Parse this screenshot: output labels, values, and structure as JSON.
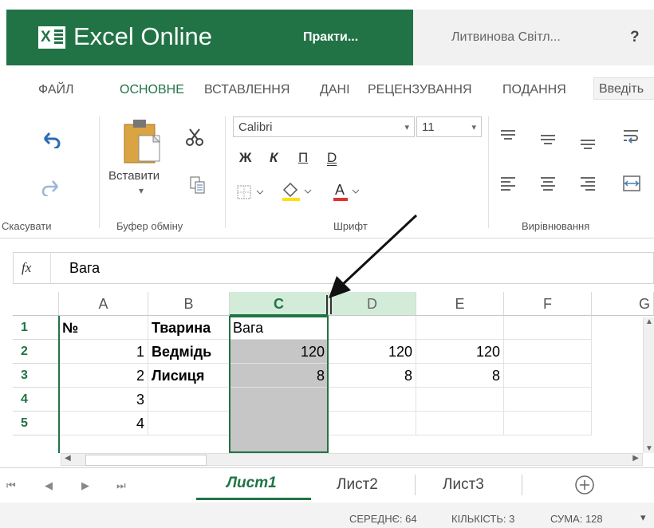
{
  "app": {
    "title": "Excel Online",
    "document": "Практи...",
    "user": "Литвинова Світл...",
    "help": "?"
  },
  "ribbon_tabs": [
    "ФАЙЛ",
    "ОСНОВНЕ",
    "ВСТАВЛЕННЯ",
    "ДАНІ",
    "РЕЦЕНЗУВАННЯ",
    "ПОДАННЯ"
  ],
  "tell_me_placeholder": "Введіть",
  "ribbon": {
    "undo_group": "Скасувати",
    "clipboard_group": "Буфер обміну",
    "paste_label": "Вставити",
    "font_group": "Шрифт",
    "alignment_group": "Вирівнювання",
    "font_name": "Calibri",
    "font_size": "11",
    "bold": "Ж",
    "italic": "К",
    "underline": "П",
    "double_underline": "D",
    "font_color": "A"
  },
  "formula_bar": {
    "fx": "fx",
    "value": "Вага"
  },
  "grid": {
    "columns": [
      "A",
      "B",
      "C",
      "D",
      "E",
      "F",
      "G"
    ],
    "rows": [
      {
        "n": "1",
        "A": "№",
        "B": "Тварина",
        "C": "Вага",
        "D": "",
        "E": ""
      },
      {
        "n": "2",
        "A": "1",
        "B": "Ведмідь",
        "C": "120",
        "D": "120",
        "E": "120"
      },
      {
        "n": "3",
        "A": "2",
        "B": "Лисиця",
        "C": "8",
        "D": "8",
        "E": "8"
      },
      {
        "n": "4",
        "A": "3",
        "B": "",
        "C": "",
        "D": "",
        "E": ""
      },
      {
        "n": "5",
        "A": "4",
        "B": "",
        "C": "",
        "D": "",
        "E": ""
      }
    ]
  },
  "sheets": [
    "Лист1",
    "Лист2",
    "Лист3"
  ],
  "active_sheet": "Лист1",
  "status": {
    "average": "СЕРЕДНЄ: 64",
    "count": "КІЛЬКІСТЬ: 3",
    "sum": "СУМА: 128"
  },
  "colors": {
    "excel_green": "#217346",
    "selected_column": "#c6c6c6",
    "header_highlight": "#d3ecd9"
  }
}
